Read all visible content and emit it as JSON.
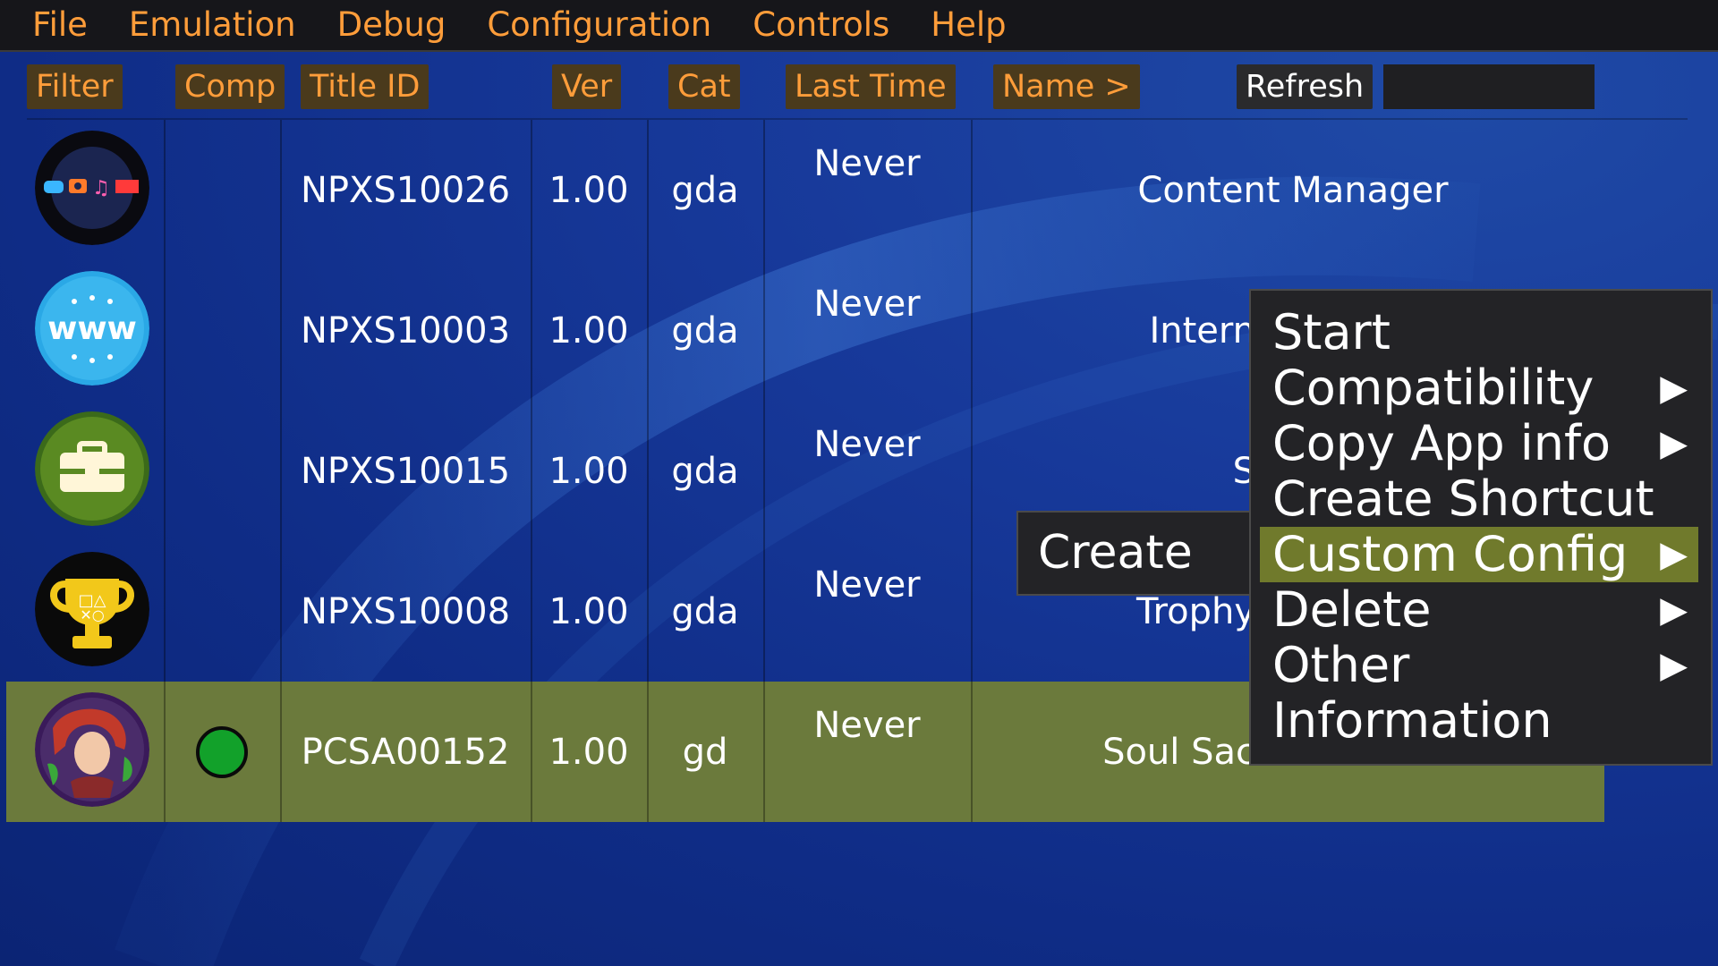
{
  "menubar": {
    "items": [
      "File",
      "Emulation",
      "Debug",
      "Configuration",
      "Controls",
      "Help"
    ]
  },
  "header": {
    "filter": "Filter",
    "comp": "Comp",
    "title_id": "Title ID",
    "ver": "Ver",
    "cat": "Cat",
    "last_time": "Last Time",
    "name": "Name >",
    "refresh": "Refresh",
    "search_value": ""
  },
  "rows": [
    {
      "icon": "content-manager-icon",
      "title_id": "NPXS10026",
      "ver": "1.00",
      "cat": "gda",
      "last_time": "Never",
      "name": "Content Manager",
      "selected": false,
      "comp": false
    },
    {
      "icon": "internet-browser-icon",
      "title_id": "NPXS10003",
      "ver": "1.00",
      "cat": "gda",
      "last_time": "Never",
      "name": "Intern",
      "selected": false,
      "comp": false
    },
    {
      "icon": "toolbox-icon",
      "title_id": "NPXS10015",
      "ver": "1.00",
      "cat": "gda",
      "last_time": "Never",
      "name": "S",
      "selected": false,
      "comp": false
    },
    {
      "icon": "trophy-icon",
      "title_id": "NPXS10008",
      "ver": "1.00",
      "cat": "gda",
      "last_time": "Never",
      "name": "Trophy",
      "selected": false,
      "comp": false
    },
    {
      "icon": "game-icon",
      "title_id": "PCSA00152",
      "ver": "1.00",
      "cat": "gd",
      "last_time": "Never",
      "name": "Soul Sac",
      "selected": true,
      "comp": true
    }
  ],
  "context_menu": {
    "items": [
      {
        "label": "Start",
        "submenu": false
      },
      {
        "label": "Compatibility",
        "submenu": true
      },
      {
        "label": "Copy App info",
        "submenu": true
      },
      {
        "label": "Create Shortcut",
        "submenu": false
      },
      {
        "label": "Custom Config",
        "submenu": true,
        "highlighted": true
      },
      {
        "label": "Delete",
        "submenu": true
      },
      {
        "label": "Other",
        "submenu": true
      },
      {
        "label": "Information",
        "submenu": false
      }
    ],
    "arrow": "▶"
  },
  "submenu": {
    "create": "Create"
  },
  "colors": {
    "accent": "#ff9d3a",
    "selected_row": "#6b7a3c",
    "highlight": "#707a2c",
    "menu_bg": "#232326"
  }
}
